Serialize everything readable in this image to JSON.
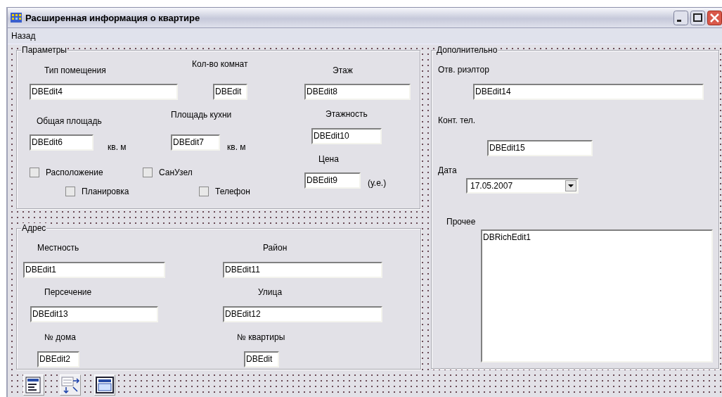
{
  "window": {
    "title": "Расширенная информация о квартире"
  },
  "menu": [
    {
      "label": "Назад"
    }
  ],
  "groups": [
    {
      "title": "Параметры",
      "items": [
        {
          "kind": "label",
          "text": "Тип помещения"
        },
        {
          "kind": "label",
          "text": "Кол-во комнат"
        },
        {
          "kind": "label",
          "text": "Этаж"
        },
        {
          "kind": "edit",
          "value": "DBEdit4"
        },
        {
          "kind": "edit",
          "value": "DBEdit"
        },
        {
          "kind": "edit",
          "value": "DBEdit8"
        },
        {
          "kind": "label",
          "text": "Общая площадь"
        },
        {
          "kind": "label",
          "text": "Площадь кухни"
        },
        {
          "kind": "label",
          "text": "Этажность"
        },
        {
          "kind": "edit",
          "value": "DBEdit6"
        },
        {
          "kind": "label",
          "text": "кв. м"
        },
        {
          "kind": "edit",
          "value": "DBEdit7"
        },
        {
          "kind": "label",
          "text": "кв. м"
        },
        {
          "kind": "edit",
          "value": "DBEdit10"
        },
        {
          "kind": "label",
          "text": "Цена"
        },
        {
          "kind": "checkbox",
          "text": "Расположение",
          "checked": false
        },
        {
          "kind": "checkbox",
          "text": "СанУзел",
          "checked": false
        },
        {
          "kind": "checkbox",
          "text": "Планировка",
          "checked": false
        },
        {
          "kind": "checkbox",
          "text": "Телефон",
          "checked": false
        },
        {
          "kind": "edit",
          "value": "DBEdit9"
        },
        {
          "kind": "label",
          "text": "(у.е.)"
        }
      ]
    },
    {
      "title": "Адрес",
      "items": [
        {
          "kind": "label",
          "text": "Местность"
        },
        {
          "kind": "label",
          "text": "Район"
        },
        {
          "kind": "edit",
          "value": "DBEdit1"
        },
        {
          "kind": "edit",
          "value": "DBEdit11"
        },
        {
          "kind": "label",
          "text": "Персечение"
        },
        {
          "kind": "label",
          "text": "Улица"
        },
        {
          "kind": "edit",
          "value": "DBEdit13"
        },
        {
          "kind": "edit",
          "value": "DBEdit12"
        },
        {
          "kind": "label",
          "text": "№ дома"
        },
        {
          "kind": "label",
          "text": "№ квартиры"
        },
        {
          "kind": "edit",
          "value": "DBEdit2"
        },
        {
          "kind": "edit",
          "value": "DBEdit"
        }
      ]
    },
    {
      "title": "Дополнительно",
      "items": [
        {
          "kind": "label",
          "text": "Отв. риэлтор"
        },
        {
          "kind": "edit",
          "value": "DBEdit14"
        },
        {
          "kind": "label",
          "text": "Конт. тел."
        },
        {
          "kind": "edit",
          "value": "DBEdit15"
        },
        {
          "kind": "label",
          "text": "Дата"
        },
        {
          "kind": "combo",
          "value": "17.05.2007"
        },
        {
          "kind": "label",
          "text": "Прочее"
        },
        {
          "kind": "memo",
          "value": "DBRichEdit1"
        }
      ]
    }
  ]
}
